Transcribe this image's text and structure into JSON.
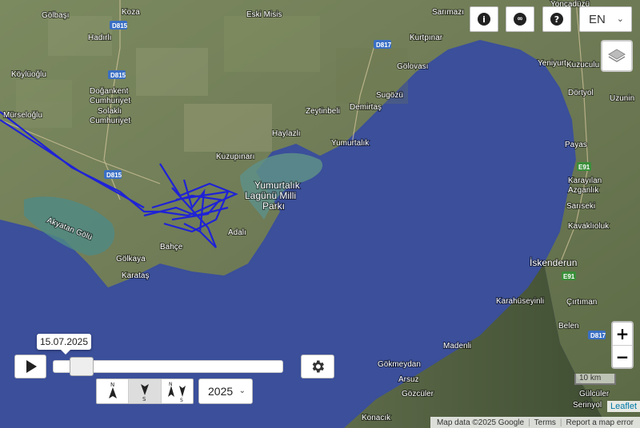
{
  "header": {
    "info_icon": "info-icon",
    "link_icon": "link-icon",
    "help_icon": "help-icon",
    "language": "EN"
  },
  "map": {
    "places": [
      "Gölbaşı",
      "Koza",
      "Eski Misis",
      "Sarımazı",
      "Yoncadüzü",
      "Hadırlı",
      "Kurtpınar",
      "Gölovası",
      "Yeniyurt",
      "Kuzuculu",
      "Köylüoğlu",
      "Doğankent Cumhuriyet",
      "Solaklı Cumhuriyet",
      "Sugözü",
      "Dörtyol",
      "Zeytinbeli",
      "Demirtaş",
      "Uzunin",
      "Mürseloğlu",
      "Haylazlı",
      "Yumurtalık",
      "Payas",
      "Kuzupınarı",
      "Karayılan",
      "Azganlık",
      "Sarıseki",
      "Kavaklıoluk",
      "Yumurtalık Lagünü Milli Parkı",
      "Akyatan Gölü",
      "Adalı",
      "Bahçe",
      "Gölkaya",
      "Karataş",
      "İskenderun",
      "Karahüseyinli",
      "Çırtıman",
      "Belen",
      "Madenli",
      "Gökmeydan",
      "Arsuz",
      "Gözcüler",
      "Konacık",
      "Gülcüler",
      "Serinyol"
    ],
    "roads": [
      "D815",
      "D815",
      "D815",
      "D817",
      "D817",
      "E91",
      "E91",
      "D817"
    ],
    "track_color": "#1f22d6",
    "water_color": "#3b4f9a",
    "land_color": "#6f7d56"
  },
  "controls": {
    "date": "15.07.2025",
    "year": "2025",
    "slider_progress": 0.08,
    "compass": [
      "N",
      "S",
      "S"
    ]
  },
  "zoom": {
    "in": "+",
    "out": "−"
  },
  "scale": "10 km",
  "attribution": {
    "mapdata": "Map data ©2025 Google",
    "terms": "Terms",
    "report": "Report a map error",
    "leaflet": "Leaflet"
  }
}
